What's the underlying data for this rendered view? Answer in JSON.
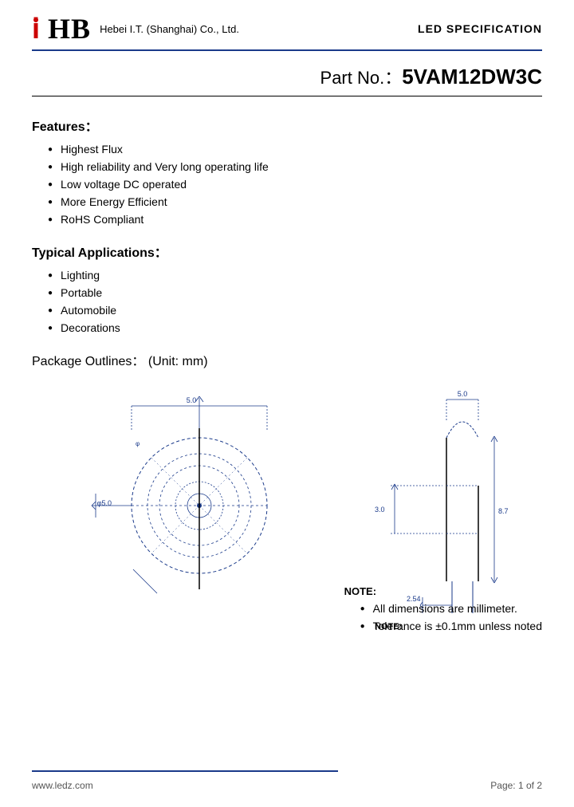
{
  "header": {
    "company": "Hebei I.T. (Shanghai) Co., Ltd.",
    "spec_label": "LED SPECIFICATION"
  },
  "part_number": {
    "label": "Part  No.：",
    "value": "5VAM12DW3C"
  },
  "features": {
    "title": "Features：",
    "items": [
      "Highest Flux",
      "High reliability and Very long operating life",
      "Low voltage DC operated",
      "More Energy Efficient",
      "RoHS Compliant"
    ]
  },
  "applications": {
    "title": "Typical Applications：",
    "items": [
      "Lighting",
      "Portable",
      "Automobile",
      "Decorations"
    ]
  },
  "package": {
    "title": "Package Outlines：",
    "unit": "  (Unit: mm)"
  },
  "notes": {
    "title": "NOTE:",
    "items": [
      "All dimensions are millimeter.",
      "Tolerance is ±0.1mm unless noted"
    ]
  },
  "footer": {
    "website": "www.ledz.com",
    "page": "Page: 1 of 2"
  }
}
